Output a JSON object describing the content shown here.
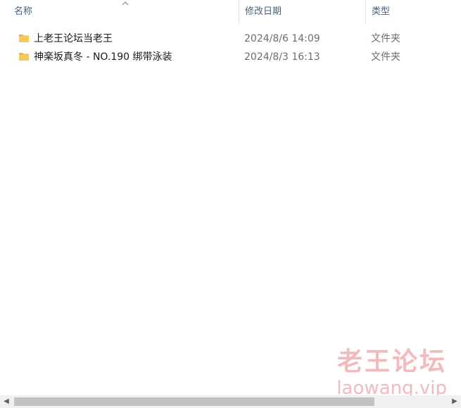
{
  "columns": {
    "name": "名称",
    "date_modified": "修改日期",
    "type": "类型"
  },
  "sort_indicator": "sort-ascending-arrow-icon",
  "files": [
    {
      "name": "上老王论坛当老王",
      "date_modified": "2024/8/6 14:09",
      "type": "文件夹",
      "icon": "folder-icon"
    },
    {
      "name": "神楽坂真冬 - NO.190 绑带泳装",
      "date_modified": "2024/8/3 16:13",
      "type": "文件夹",
      "icon": "folder-icon"
    }
  ],
  "watermark": {
    "title": "老王论坛",
    "url": "laowang.vip"
  },
  "colors": {
    "folder": "#f8c959",
    "header_text": "#4c607a",
    "watermark": "#f2b3b8",
    "scroll_thumb": "#c2c2c2"
  }
}
